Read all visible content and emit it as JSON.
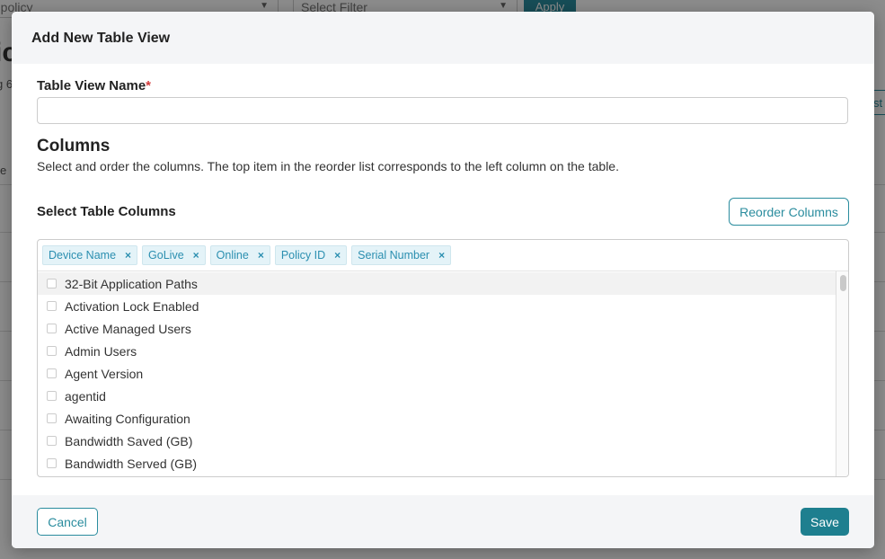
{
  "background": {
    "policy_select": "a policy",
    "filter_select": "Select Filter",
    "apply_label": "Apply",
    "heading_fragment": "ic",
    "subtitle_fragment": "g 6",
    "side_fragment": "e",
    "right_button_fragment": "st"
  },
  "modal": {
    "title": "Add New Table View",
    "name_label": "Table View Name",
    "required_mark": "*",
    "name_value": "",
    "columns_title": "Columns",
    "columns_desc": "Select and order the columns. The top item in the reorder list corresponds to the left column on the table.",
    "select_label": "Select Table Columns",
    "reorder_label": "Reorder Columns",
    "selected_tags": [
      {
        "label": "Device Name",
        "remove": "×"
      },
      {
        "label": "GoLive",
        "remove": "×"
      },
      {
        "label": "Online",
        "remove": "×"
      },
      {
        "label": "Policy ID",
        "remove": "×"
      },
      {
        "label": "Serial Number",
        "remove": "×"
      }
    ],
    "options": [
      "32-Bit Application Paths",
      "Activation Lock Enabled",
      "Active Managed Users",
      "Admin Users",
      "Agent Version",
      "agentid",
      "Awaiting Configuration",
      "Bandwidth Saved (GB)",
      "Bandwidth Served (GB)"
    ],
    "cancel_label": "Cancel",
    "save_label": "Save"
  },
  "colors": {
    "accent": "#2a8c9e",
    "save_bg": "#1e7f8f",
    "tag_text": "#2b8fb0",
    "required": "#d23b3b"
  }
}
